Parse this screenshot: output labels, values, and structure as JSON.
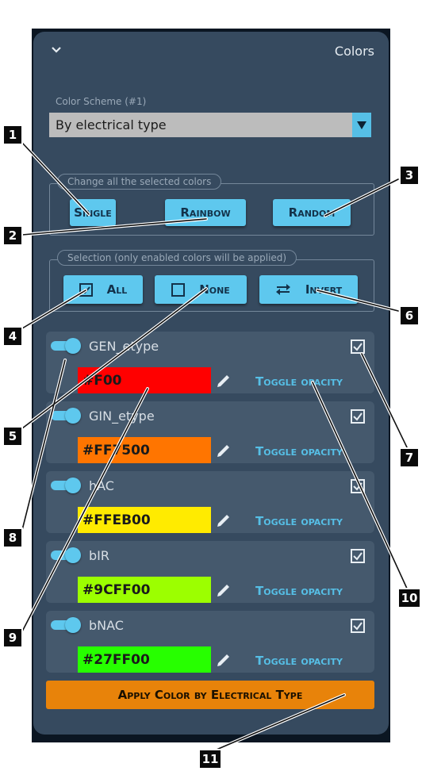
{
  "header": {
    "title": "Colors",
    "collapse_icon": "chevron-down-icon"
  },
  "scheme": {
    "label": "Color Scheme (#1)",
    "value": "By electrical type"
  },
  "change_all": {
    "legend": "Change all the selected colors",
    "buttons": [
      "Single",
      "Rainbow",
      "Random"
    ]
  },
  "selection": {
    "legend": "Selection (only enabled colors will be applied)",
    "all_label": "All",
    "none_label": "None",
    "invert_label": "Invert"
  },
  "toggle_opacity_label": "Toggle opacity",
  "colors": [
    {
      "name": "GEN_etype",
      "hex": "#F00",
      "swatch": "#ff0000",
      "enabled": true,
      "checked": true
    },
    {
      "name": "GIN_etype",
      "hex": "#FF7500",
      "swatch": "#ff7500",
      "enabled": true,
      "checked": true
    },
    {
      "name": "hAC",
      "hex": "#FFEB00",
      "swatch": "#ffeb00",
      "enabled": true,
      "checked": true
    },
    {
      "name": "bIR",
      "hex": "#9CFF00",
      "swatch": "#9cff00",
      "enabled": true,
      "checked": true
    },
    {
      "name": "bNAC",
      "hex": "#27FF00",
      "swatch": "#27ff00",
      "enabled": true,
      "checked": true
    }
  ],
  "apply_label": "Apply Color by Electrical Type",
  "callouts": [
    "1",
    "2",
    "3",
    "4",
    "5",
    "6",
    "7",
    "8",
    "9",
    "10",
    "11"
  ],
  "theme": {
    "panel": "#364a5f",
    "accent": "#5ec8ee",
    "apply": "#e8830a"
  }
}
